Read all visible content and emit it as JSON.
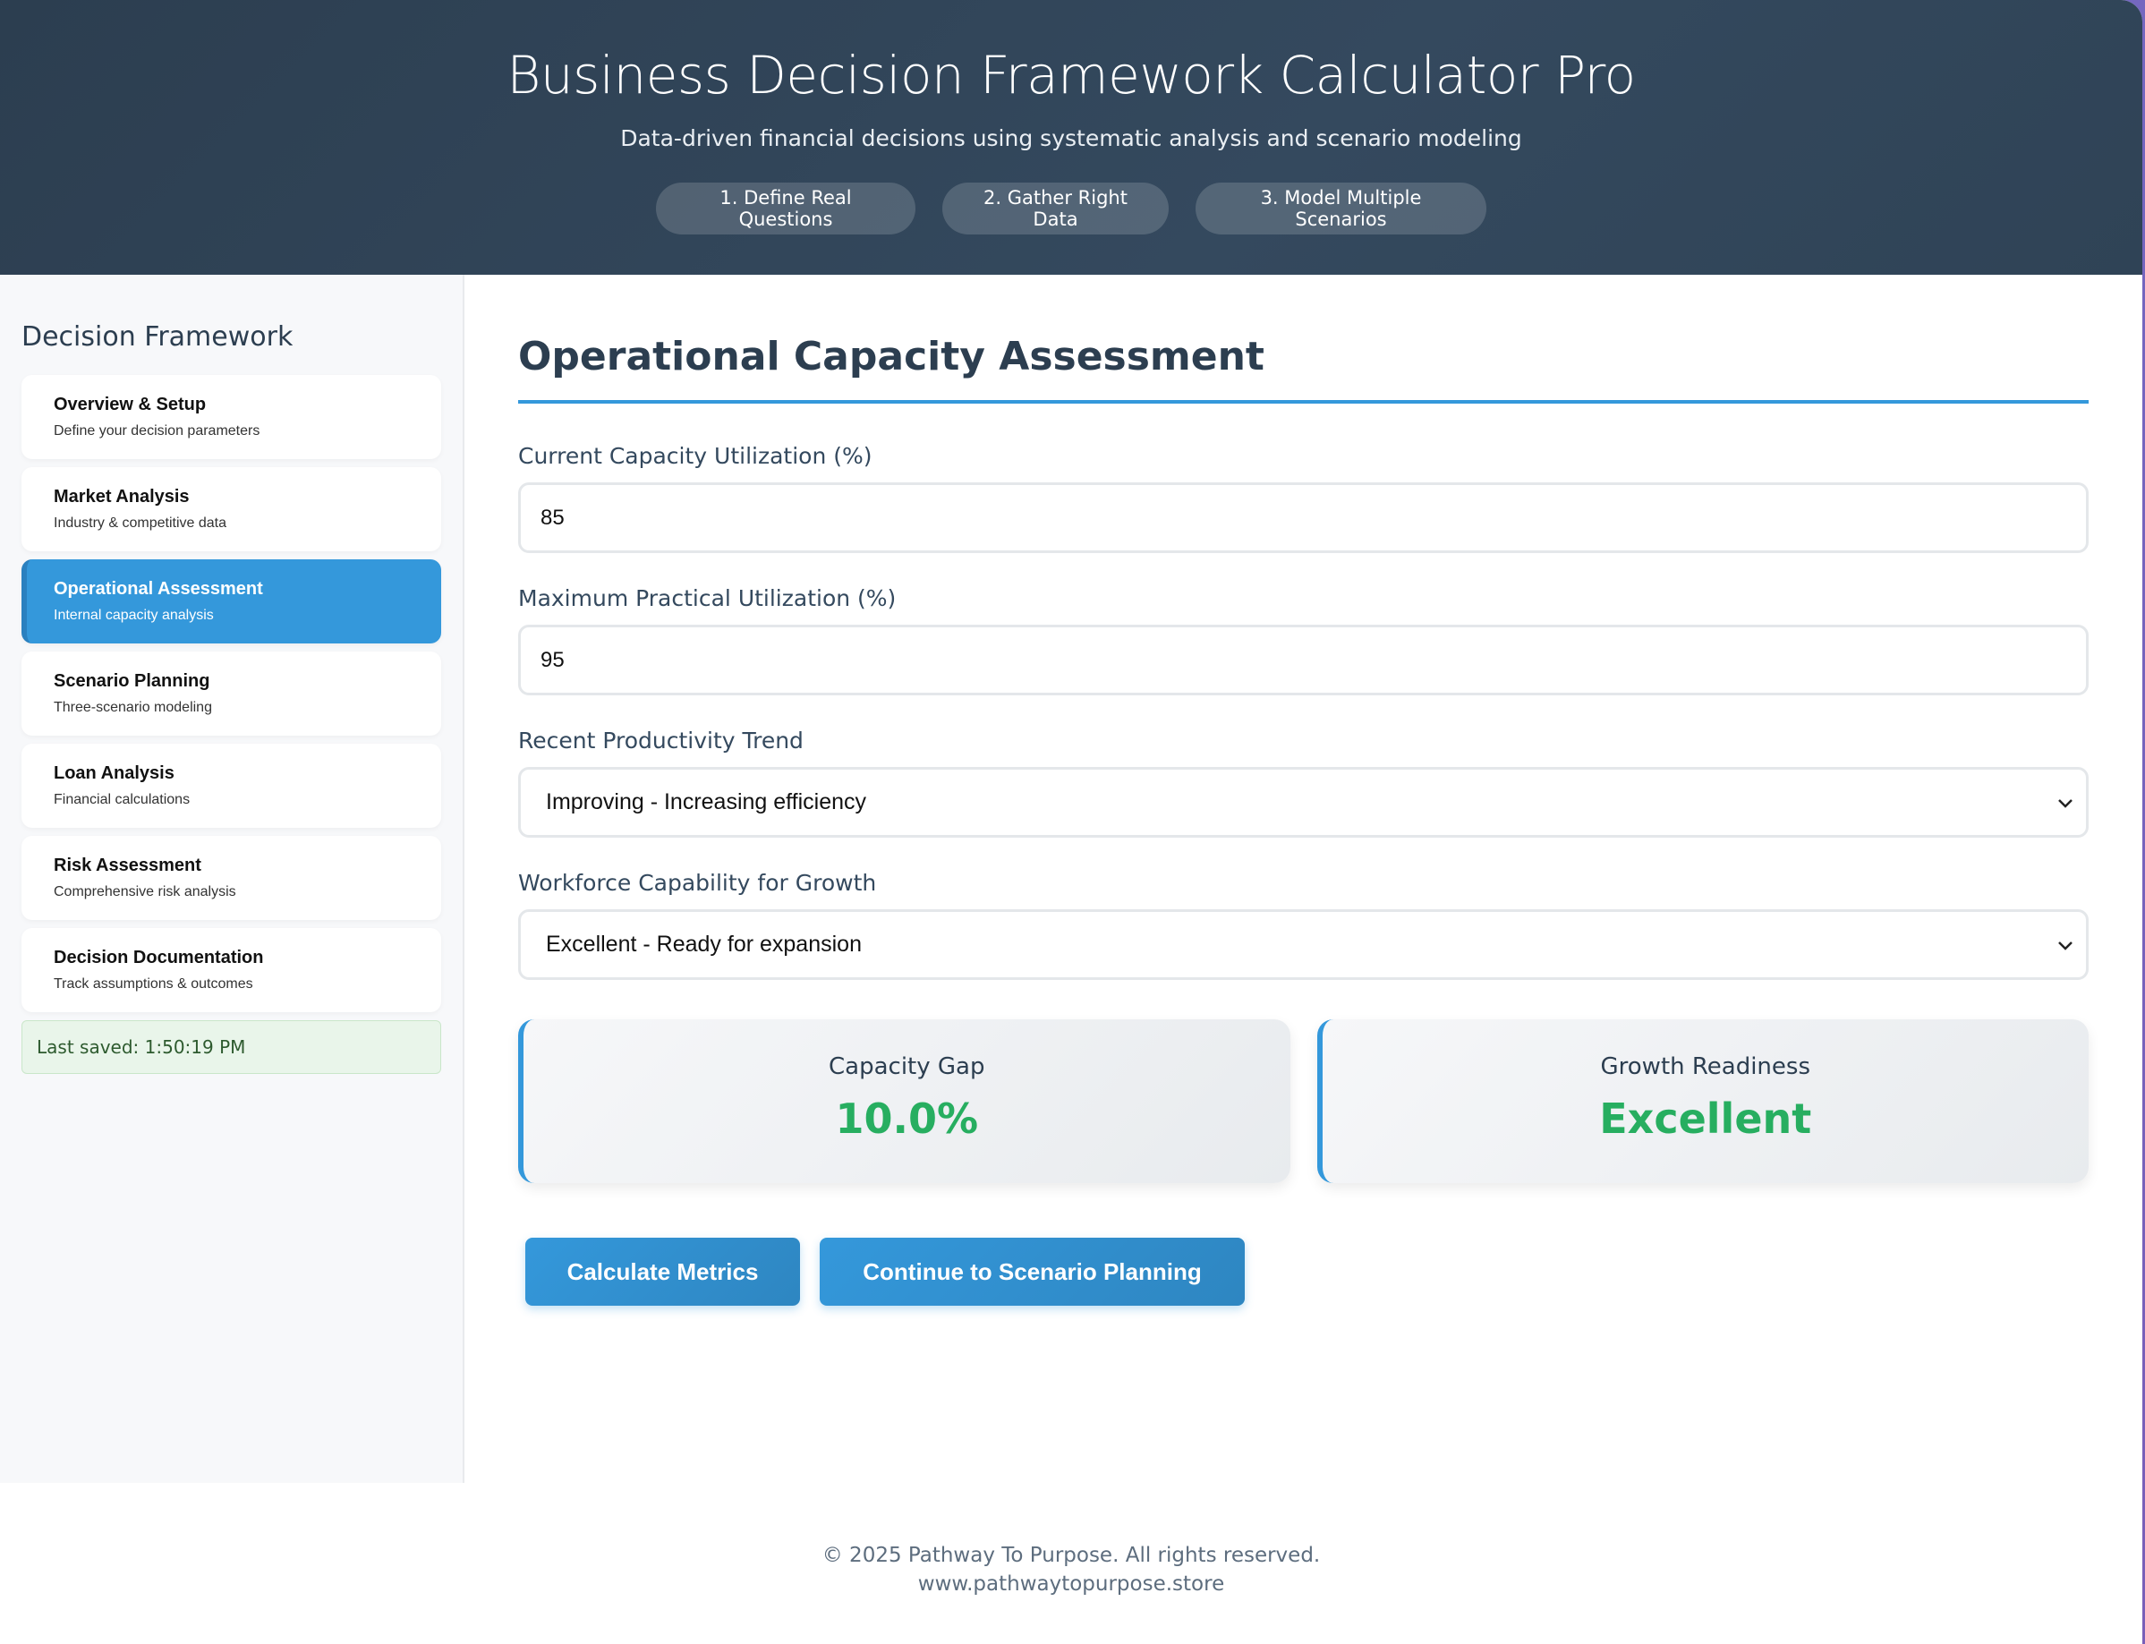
{
  "header": {
    "title": "Business Decision Framework Calculator Pro",
    "subtitle": "Data-driven financial decisions using systematic analysis and scenario modeling",
    "steps": [
      "1. Define Real Questions",
      "2. Gather Right Data",
      "3. Model Multiple Scenarios"
    ]
  },
  "sidebar": {
    "heading": "Decision Framework",
    "items": [
      {
        "title": "Overview & Setup",
        "sub": "Define your decision parameters"
      },
      {
        "title": "Market Analysis",
        "sub": "Industry & competitive data"
      },
      {
        "title": "Operational Assessment",
        "sub": "Internal capacity analysis"
      },
      {
        "title": "Scenario Planning",
        "sub": "Three-scenario modeling"
      },
      {
        "title": "Loan Analysis",
        "sub": "Financial calculations"
      },
      {
        "title": "Risk Assessment",
        "sub": "Comprehensive risk analysis"
      },
      {
        "title": "Decision Documentation",
        "sub": "Track assumptions & outcomes"
      }
    ],
    "active_index": 2,
    "last_saved": "Last saved: 1:50:19 PM"
  },
  "main": {
    "title": "Operational Capacity Assessment",
    "fields": {
      "current_capacity": {
        "label": "Current Capacity Utilization (%)",
        "value": "85"
      },
      "max_capacity": {
        "label": "Maximum Practical Utilization (%)",
        "value": "95"
      },
      "productivity_trend": {
        "label": "Recent Productivity Trend",
        "value": "Improving - Increasing efficiency"
      },
      "workforce": {
        "label": "Workforce Capability for Growth",
        "value": "Excellent - Ready for expansion"
      }
    },
    "metrics": [
      {
        "label": "Capacity Gap",
        "value": "10.0%"
      },
      {
        "label": "Growth Readiness",
        "value": "Excellent"
      }
    ],
    "buttons": {
      "calculate": "Calculate Metrics",
      "continue": "Continue to Scenario Planning"
    }
  },
  "footer": {
    "copyright": "© 2025 Pathway To Purpose. All rights reserved.",
    "website": "www.pathwaytopurpose.store"
  },
  "colors": {
    "accent": "#3498db",
    "header_bg": "#2c3e50",
    "success": "#27ae60"
  }
}
